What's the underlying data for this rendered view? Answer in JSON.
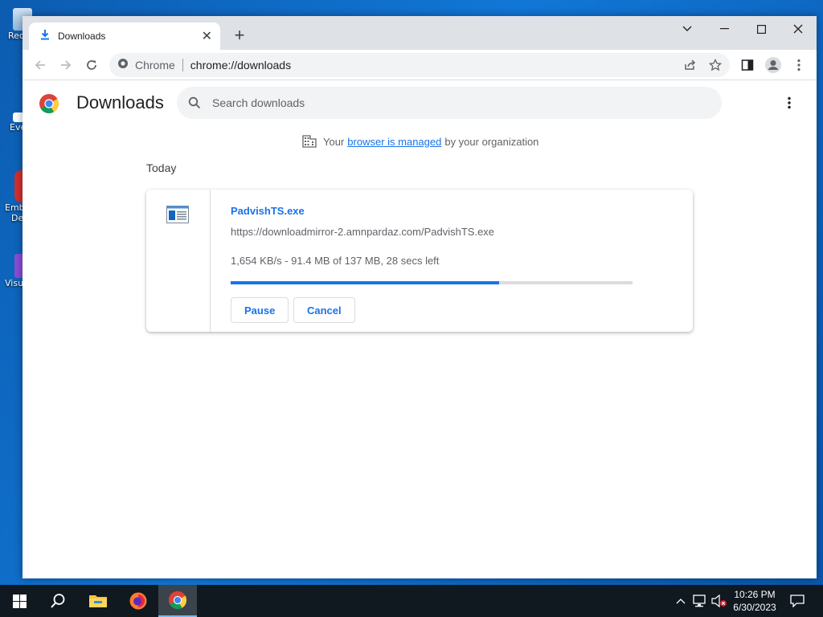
{
  "desktop": {
    "icons": [
      {
        "label": "Rec",
        "icon": "recycle-bin-icon"
      },
      {
        "label": "Eve",
        "icon": "event-viewer-icon"
      },
      {
        "label": "Emb",
        "label2": "De",
        "icon": "app-shortcut-icon"
      },
      {
        "label": "Visu",
        "icon": "visual-studio-icon"
      }
    ]
  },
  "browser": {
    "tab": {
      "title": "Downloads",
      "icon": "download-icon"
    },
    "omnibox": {
      "site_label": "Chrome",
      "url": "chrome://downloads"
    }
  },
  "page": {
    "title": "Downloads",
    "search_placeholder": "Search downloads",
    "managed": {
      "prefix": "Your",
      "link": "browser is managed",
      "suffix": "by your organization"
    },
    "section_date": "Today",
    "downloads": [
      {
        "filename": "PadvishTS.exe",
        "url": "https://downloadmirror-2.amnpardaz.com/PadvishTS.exe",
        "status": "1,654 KB/s - 91.4 MB of 137 MB, 28 secs left",
        "progress_fraction": 0.667,
        "pause_label": "Pause",
        "cancel_label": "Cancel"
      }
    ]
  },
  "taskbar": {
    "apps": [
      "start-icon",
      "search-icon",
      "file-explorer-icon",
      "firefox-icon",
      "chrome-icon"
    ],
    "clock_time": "10:26 PM",
    "clock_date": "6/30/2023"
  },
  "colors": {
    "accent": "#1a73e8",
    "desktop": "#0c5cb0",
    "taskbar": "#101820"
  }
}
